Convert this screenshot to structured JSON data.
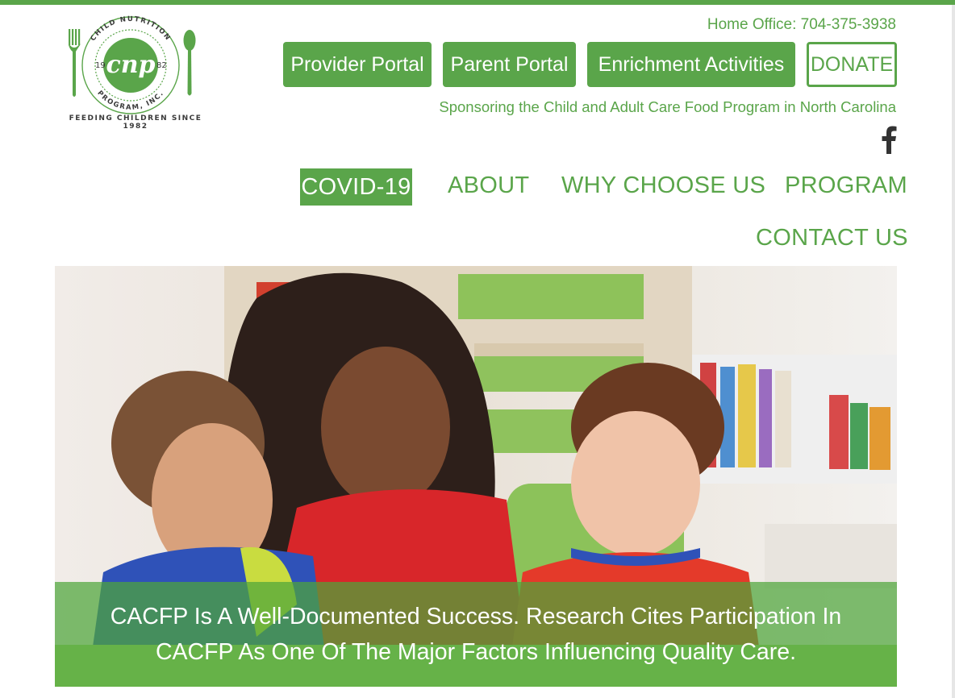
{
  "logo": {
    "monogram": "cnp",
    "ring_top": "CHILD NUTRITION",
    "ring_bottom": "PROGRAM, INC.",
    "year_left": "19",
    "year_right": "82",
    "tagline": "FEEDING CHILDREN SINCE 1982"
  },
  "header": {
    "home_office": "Home Office: 704-375-3938",
    "sponsor_line": "Sponsoring the Child and Adult Care Food Program in North Carolina",
    "social_icon": "facebook-icon"
  },
  "portal_buttons": {
    "provider": "Provider Portal",
    "parent": "Parent Portal",
    "enrichment": "Enrichment Activities",
    "donate": "DONATE"
  },
  "nav": {
    "covid": "COVID-19",
    "about": "ABOUT",
    "why": "WHY CHOOSE US",
    "program": "PROGRAM",
    "contact": "CONTACT US"
  },
  "hero": {
    "caption": "CACFP Is A Well-Documented Success. Research Cites Participation In CACFP As One Of The Major Factors Influencing Quality Care."
  },
  "colors": {
    "brand_green": "#5aa54a",
    "white": "#ffffff"
  }
}
